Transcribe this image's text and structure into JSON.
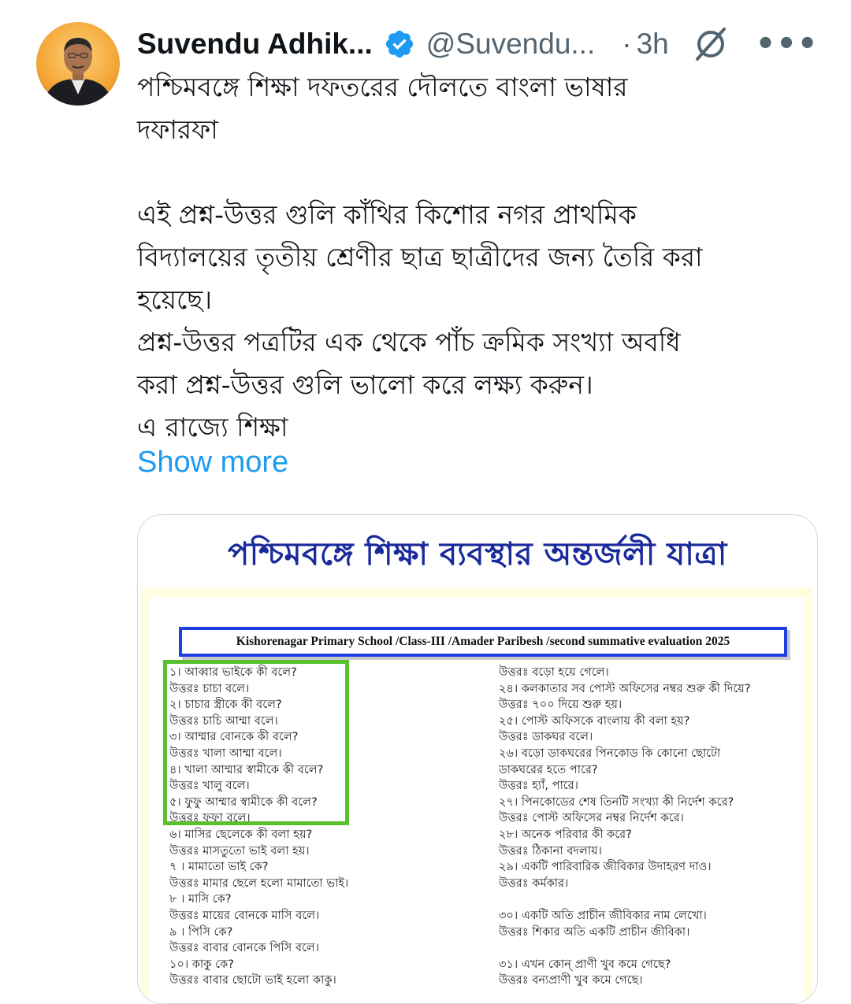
{
  "author": {
    "display_name": "Suvendu Adhik...",
    "handle": "@Suvendu...",
    "separator": "·",
    "time": "3h",
    "verified_color": "#1d9bf0"
  },
  "icons": {
    "verified": "verified-badge-icon",
    "grok": "grok-icon",
    "more": "more-options-icon"
  },
  "tweet": {
    "text": "পশ্চিমবঙ্গে শিক্ষা দফতরের দৌলতে বাংলা ভাষার\nদফারফা\n\nএই প্রশ্ন-উত্তর গুলি কাঁথির কিশোর নগর প্রাথমিক\nবিদ্যালয়ের তৃতীয় শ্রেণীর ছাত্র ছাত্রীদের জন্য তৈরি করা\nহয়েছে।\nপ্রশ্ন-উত্তর পত্রটির এক থেকে পাঁচ ক্রমিক সংখ্যা অবধি\nকরা প্রশ্ন-উত্তর গুলি ভালো করে লক্ষ্য করুন।\nএ রাজ্যে শিক্ষা",
    "show_more": "Show more",
    "link_color": "#1d9bf0"
  },
  "media": {
    "banner": "পশ্চিমবঙ্গে শিক্ষা ব্যবস্থার অন্তর্জলী যাত্রা",
    "school_line": "Kishorenagar Primary School /Class-III /Amader  Paribesh /second summative evaluation 2025",
    "left_lines": [
      "১। আব্বার ভাইকে কী বলে?",
      "উত্তরঃ চাচা বলে।",
      "২। চাচার স্ত্রীকে কী বলে?",
      "উত্তরঃ  চাচি আম্মা বলে।",
      "৩। আম্মার বোনকে কী বলে?",
      "উত্তরঃ খালা আম্মা বলে।",
      "৪। খালা আম্মার স্বামীকে কী বলে?",
      "উত্তরঃ খালু বলে।",
      "৫। ফুফু আম্মার স্বামীকে কী বলে?",
      "উত্তরঃ ফুফা বলে।",
      "৬। মাসির ছেলেকে কী বলা হয়?",
      "উত্তরঃ মাসতুতো ভাই বলা হয়।",
      "৭ । মামাতো ভাই কে?",
      "উত্তরঃ মামার ছেলে হলো মামাতো ভাই।",
      "৮ । মাসি কে?",
      "উত্তরঃ মায়ের বোনকে মাসি বলে।",
      "৯ । পিসি কে?",
      "উত্তরঃ বাবার বোনকে পিসি বলে।",
      "১০। কাকু কে?",
      "উত্তরঃ বাবার ছোটো ভাই হলো কাকু।"
    ],
    "right_lines": [
      "উত্তরঃ বড়ো হয়ে গেলে।",
      "২৪। কলকাতার সব পোস্ট অফিসের নম্বর শুরু কী দিয়ে?",
      "উত্তরঃ ৭০০ দিয়ে শুরু হয়।",
      "২৫। পোস্ট অফিসকে বাংলায় কী বলা হয়?",
      "উত্তরঃ ডাকঘর বলে।",
      "২৬। বড়ো ডাকঘরের পিনকোড কি কোনো ছোটো",
      "ডাকঘরের হতে পারে?",
      "উত্তরঃ হ্যাঁ, পারে।",
      "২৭। পিনকোডের শেষ তিনটি সংখ্যা কী নির্দেশ করে?",
      "উত্তরঃ পোস্ট অফিসের নম্বর নির্দেশ করে।",
      "২৮। অনেক পরিবার কী করে?",
      "উত্তরঃ ঠিকানা বদলায়।",
      "২৯। একটি পারিবারিক জীবিকার উদাহরণ দাও।",
      "উত্তরঃ কর্মকার।",
      "",
      "৩০। একটি অতি প্রাচীন জীবিকার নাম লেখো।",
      "উত্তরঃ শিকার অতি একটি প্রাচীন জীবিকা।",
      "",
      "৩১। এখন কোন্ প্রাণী খুব কমে গেছে?",
      "উত্তরঃ বন্যপ্রাণী খুব কমে গেছে।"
    ],
    "banner_color": "#1a2a9c",
    "box_border_color": "#1f3fe0",
    "highlight_color": "#57c02c"
  }
}
